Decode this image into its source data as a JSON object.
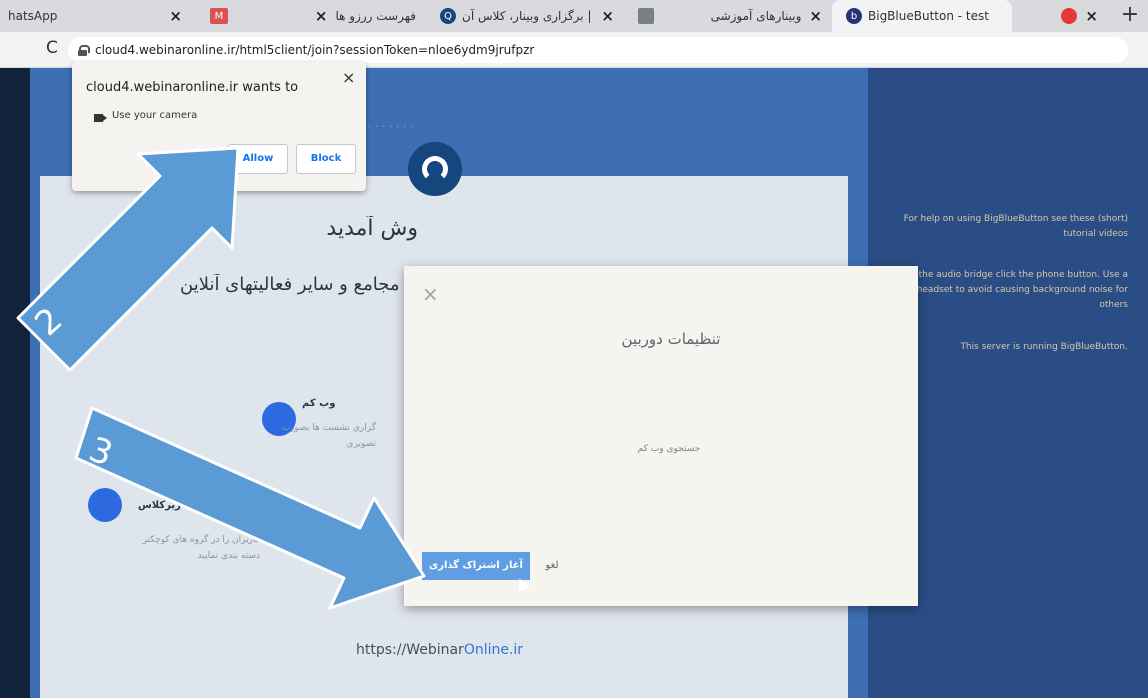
{
  "browser": {
    "tabs": [
      {
        "label": "hatsApp",
        "favicon": ""
      },
      {
        "label": "",
        "favicon": "M"
      },
      {
        "label": "فهرست ررزو ها",
        "favicon": ""
      },
      {
        "label": "وبینار آنلاین | برگزاری وبینار، کلاس آن",
        "favicon": "Q"
      },
      {
        "label": "",
        "favicon": ""
      },
      {
        "label": "وبینارهای آموزشی",
        "favicon": ""
      },
      {
        "label": "BigBlueButton - test",
        "favicon": "b"
      },
      {
        "label": "",
        "favicon": "●"
      }
    ],
    "url": "cloud4.webinaronline.ir/html5client/join?sessionToken=nloe6ydm9jrufpzr"
  },
  "permission_popup": {
    "title": "cloud4.webinaronline.ir wants to",
    "request": "Use your camera",
    "allow_label": "Allow",
    "block_label": "Block"
  },
  "welcome": {
    "title": "وش آمدید",
    "subtitle": "ستها، مجامع و سایر فعالیتهای آنلاین.",
    "features": [
      {
        "title": "وب کم",
        "desc": "گزاری نشست ها بصورت\nتصویری"
      },
      {
        "title": "ایجاد زیرکلاس",
        "desc": "کاربران را در گروه های کوچکتر\nدسته بندی نمایید"
      }
    ],
    "footer_prefix": "https://",
    "footer_main": "Webinar",
    "footer_accent": "Online.ir"
  },
  "sidebar": {
    "lines": [
      "For help on using BigBlueButton see these (short) tutorial videos",
      "join the audio bridge click the phone button. Use a headset to avoid causing background noise for others",
      "This server is running BigBlueButton."
    ]
  },
  "modal": {
    "title": "تنظیمات دوربین",
    "status": "جستجوی وب کم",
    "share_label": "آغاز اشتراک گذاری",
    "cancel_label": "لغو"
  },
  "annotations": [
    {
      "number": "2",
      "target": "Allow"
    },
    {
      "number": "3",
      "target": "آغاز اشتراک گذاری"
    }
  ],
  "colors": {
    "arrow": "#5b9bd5",
    "share_button": "#5f9ee2",
    "sidebar": "#2a4d86"
  }
}
